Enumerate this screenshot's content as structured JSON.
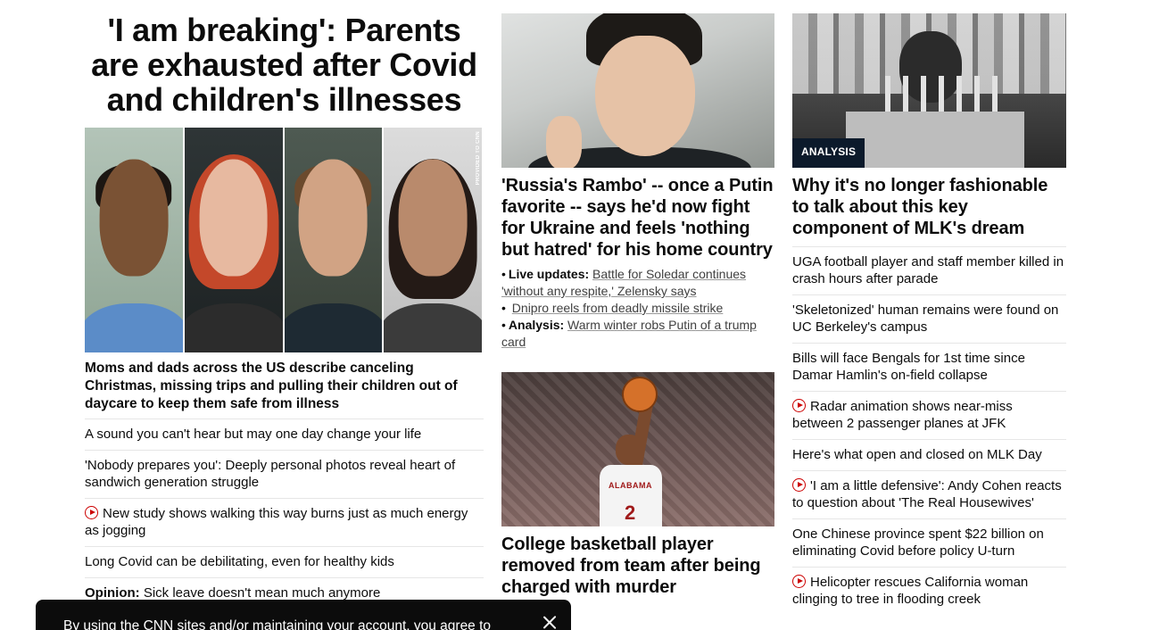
{
  "left": {
    "headline": "'I am breaking': Parents are exhausted after Covid and children's illnesses",
    "photo_credit": "PROVIDED TO CNN",
    "dek": "Moms and dads across the US describe canceling Christmas, missing trips and pulling their children out of daycare to keep them safe from illness",
    "links": [
      {
        "prefix": "",
        "video": false,
        "text": "A sound you can't hear but may one day change your life"
      },
      {
        "prefix": "",
        "video": false,
        "text": "'Nobody prepares you': Deeply personal photos reveal heart of sandwich generation struggle"
      },
      {
        "prefix": "",
        "video": true,
        "text": "New study shows walking this way burns just as much energy as jogging"
      },
      {
        "prefix": "",
        "video": false,
        "text": "Long Covid can be debilitating, even for healthy kids"
      },
      {
        "prefix": "Opinion:",
        "video": false,
        "text": "Sick leave doesn't mean much anymore"
      }
    ]
  },
  "middle": {
    "top_story": {
      "headline": "'Russia's Rambo' -- once a Putin favorite -- says he'd now fight for Ukraine and feels 'nothing but hatred' for his home country",
      "bullets": [
        {
          "prefix": "Live updates:",
          "text": "Battle for Soledar continues 'without any respite,' Zelensky says"
        },
        {
          "prefix": "",
          "text": "Dnipro reels from deadly missile strike"
        },
        {
          "prefix": "Analysis:",
          "text": "Warm winter robs Putin of a trump card"
        }
      ]
    },
    "second_story": {
      "headline": "College basketball player removed from team after being charged with murder",
      "jersey_number": "2",
      "jersey_team": "ALABAMA"
    }
  },
  "right": {
    "badge": "ANALYSIS",
    "headline": "Why it's no longer fashionable to talk about this key component of MLK's dream",
    "links": [
      {
        "video": false,
        "text": "UGA football player and staff member killed in crash hours after parade"
      },
      {
        "video": false,
        "text": "'Skeletonized' human remains were found on UC Berkeley's campus"
      },
      {
        "video": false,
        "text": "Bills will face Bengals for 1st time since Damar Hamlin's on-field collapse"
      },
      {
        "video": true,
        "text": "Radar animation shows near-miss between 2 passenger planes at JFK"
      },
      {
        "video": false,
        "text": "Here's what open and closed on MLK Day"
      },
      {
        "video": true,
        "text": "'I am a little defensive': Andy Cohen reacts to question about 'The Real Housewives'"
      },
      {
        "video": false,
        "text": "One Chinese province spent $22 billion on eliminating Covid before policy U-turn"
      },
      {
        "video": true,
        "text": "Helicopter rescues California woman clinging to tree in flooding creek"
      }
    ]
  },
  "cookie_banner": {
    "text": "By using the CNN sites and/or maintaining your account, you agree to"
  },
  "colors": {
    "text": "#0c0c0c",
    "video_icon": "#cc0000",
    "badge_bg": "#0c1a2b",
    "divider": "#e6e6e6",
    "banner_bg": "#0c0c0c"
  },
  "icons": {
    "video": "play-circle-icon",
    "close": "close-icon"
  }
}
